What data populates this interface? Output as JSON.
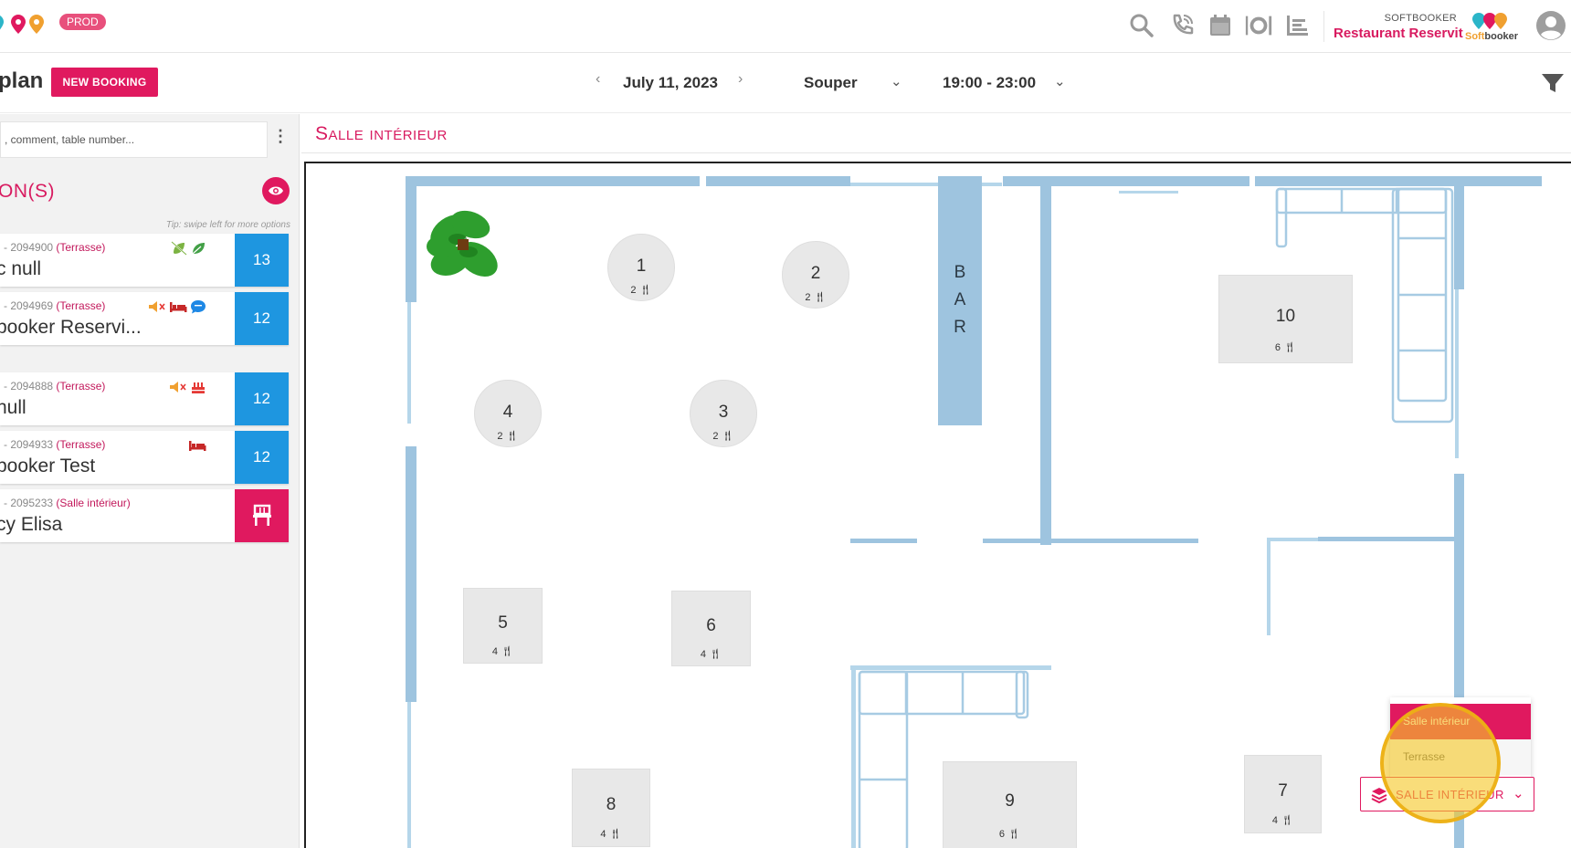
{
  "topbar": {
    "env_badge": "PROD",
    "icons": [
      "search-icon",
      "phone-icon",
      "calendar-icon",
      "restaurant-icon",
      "list-icon"
    ],
    "brand_small": "SOFTBOOKER",
    "brand_name": "Restaurant Reservit",
    "logo_text_soft": "Soft",
    "logo_text_booker": "booker"
  },
  "subbar": {
    "page_title": "plan",
    "new_booking_label": "NEW BOOKING",
    "date": "July 11, 2023",
    "service": "Souper",
    "time_range": "19:00 - 23:00"
  },
  "sidebar": {
    "search_placeholder": ", comment, table number...",
    "section_title": "ON(S)",
    "tip": "Tip: swipe left for more options",
    "reservations": [
      {
        "meta_prefix": "l - 2094900 ",
        "area": "(Terrasse)",
        "name": "c null",
        "badge": "13",
        "icons": [
          "no-vegan-icon",
          "leaf-icon"
        ]
      },
      {
        "meta_prefix": "l - 2094969 ",
        "area": "(Terrasse)",
        "name": "booker Reservi...",
        "badge": "12",
        "icons": [
          "mute-icon",
          "bed-icon",
          "chat-icon"
        ]
      },
      {
        "meta_prefix": "l - 2094888 ",
        "area": "(Terrasse)",
        "name": " null",
        "badge": "12",
        "icons": [
          "mute-icon",
          "cake-icon"
        ]
      },
      {
        "meta_prefix": "l - 2094933 ",
        "area": "(Terrasse)",
        "name": "booker Test",
        "badge": "12",
        "icons": [
          "bed-icon"
        ]
      },
      {
        "meta_prefix": "l - 2095233 ",
        "area": "(Salle intérieur)",
        "name": "cy Elisa",
        "badge": "",
        "icons": []
      }
    ]
  },
  "floor": {
    "room_title": "Salle intérieur",
    "bar_letters": [
      "B",
      "A",
      "R"
    ],
    "tables": [
      {
        "num": "1",
        "cap": "2"
      },
      {
        "num": "2",
        "cap": "2"
      },
      {
        "num": "3",
        "cap": "2"
      },
      {
        "num": "4",
        "cap": "2"
      },
      {
        "num": "5",
        "cap": "4"
      },
      {
        "num": "6",
        "cap": "4"
      },
      {
        "num": "7",
        "cap": "4"
      },
      {
        "num": "8",
        "cap": "4"
      },
      {
        "num": "9",
        "cap": "6"
      },
      {
        "num": "10",
        "cap": "6"
      }
    ]
  },
  "room_dropdown": {
    "options": [
      "Salle intérieur",
      "Terrasse"
    ],
    "selected_label": "SALLE INTÉRIEUR"
  },
  "colors": {
    "accent": "#e0195f",
    "badge_blue": "#1e96e0",
    "wall_blue": "#9ec4df",
    "highlight": "#f6c828"
  }
}
